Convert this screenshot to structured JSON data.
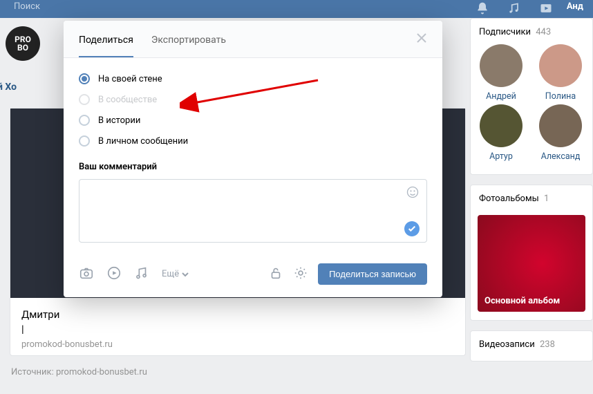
{
  "topbar": {
    "search_placeholder": "Поиск",
    "user_label": "Анд"
  },
  "profile": {
    "avatar_lines": [
      "PRO",
      "BO"
    ],
    "name_partial": "Дмитрий Хо",
    "post_title_line1": "Дмитри",
    "post_title_line2": "|",
    "post_domain": "promokod-bonusbet.ru",
    "source_text": "Источник: promokod-bonusbet.ru"
  },
  "sidebar": {
    "subscribers_title": "Подписчики",
    "subscribers_count": "443",
    "subscribers": [
      {
        "name": "Андрей"
      },
      {
        "name": "Полина"
      },
      {
        "name": "Артур"
      },
      {
        "name": "Александ"
      }
    ],
    "photos_title": "Фотоальбомы",
    "photos_count": "1",
    "album_label": "Основной альбом",
    "album_items": "",
    "videos_title": "Видеозаписи",
    "videos_count": "238"
  },
  "modal": {
    "tab_share": "Поделиться",
    "tab_export": "Экспортировать",
    "options": {
      "own_wall": "На своей стене",
      "community": "В сообществе",
      "story": "В истории",
      "dm": "В личном сообщении"
    },
    "comment_label": "Ваш комментарий",
    "more_label": "Ещё",
    "submit_label": "Поделиться записью"
  }
}
